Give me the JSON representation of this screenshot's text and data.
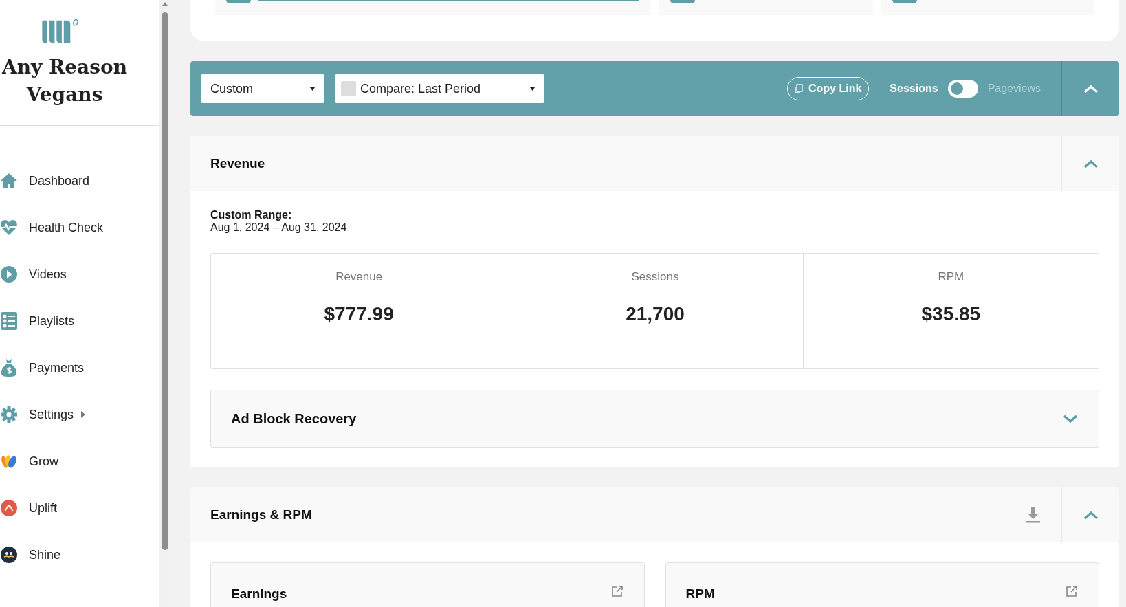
{
  "sidebar": {
    "brand": "Any Reason Vegans",
    "items": [
      {
        "label": "Dashboard",
        "kind": "home",
        "expandable": false
      },
      {
        "label": "Health Check",
        "kind": "heart",
        "expandable": false
      },
      {
        "label": "Videos",
        "kind": "play",
        "expandable": false
      },
      {
        "label": "Playlists",
        "kind": "list",
        "expandable": false
      },
      {
        "label": "Payments",
        "kind": "money",
        "expandable": false
      },
      {
        "label": "Settings",
        "kind": "gear",
        "expandable": true
      },
      {
        "label": "Grow",
        "kind": "grow",
        "expandable": false
      },
      {
        "label": "Uplift",
        "kind": "uplift",
        "expandable": false
      },
      {
        "label": "Shine",
        "kind": "shine",
        "expandable": false
      }
    ]
  },
  "toolbar": {
    "date_range": "Custom",
    "compare": {
      "label": "Compare: Last Period",
      "checked": false
    },
    "copy_link": "Copy Link",
    "metric_toggle": {
      "left": "Sessions",
      "right": "Pageviews",
      "on": false
    },
    "expanded": true
  },
  "revenue": {
    "title": "Revenue",
    "expanded": true,
    "range_label": "Custom Range:",
    "range": "Aug 1, 2024 – Aug 31, 2024",
    "stats": [
      {
        "label": "Revenue",
        "value": "$777.99"
      },
      {
        "label": "Sessions",
        "value": "21,700"
      },
      {
        "label": "RPM",
        "value": "$35.85"
      }
    ],
    "ad_block": {
      "title": "Ad Block Recovery",
      "expanded": false
    }
  },
  "earnings": {
    "title": "Earnings & RPM",
    "expanded": true,
    "charts": [
      {
        "title": "Earnings"
      },
      {
        "title": "RPM"
      }
    ]
  }
}
